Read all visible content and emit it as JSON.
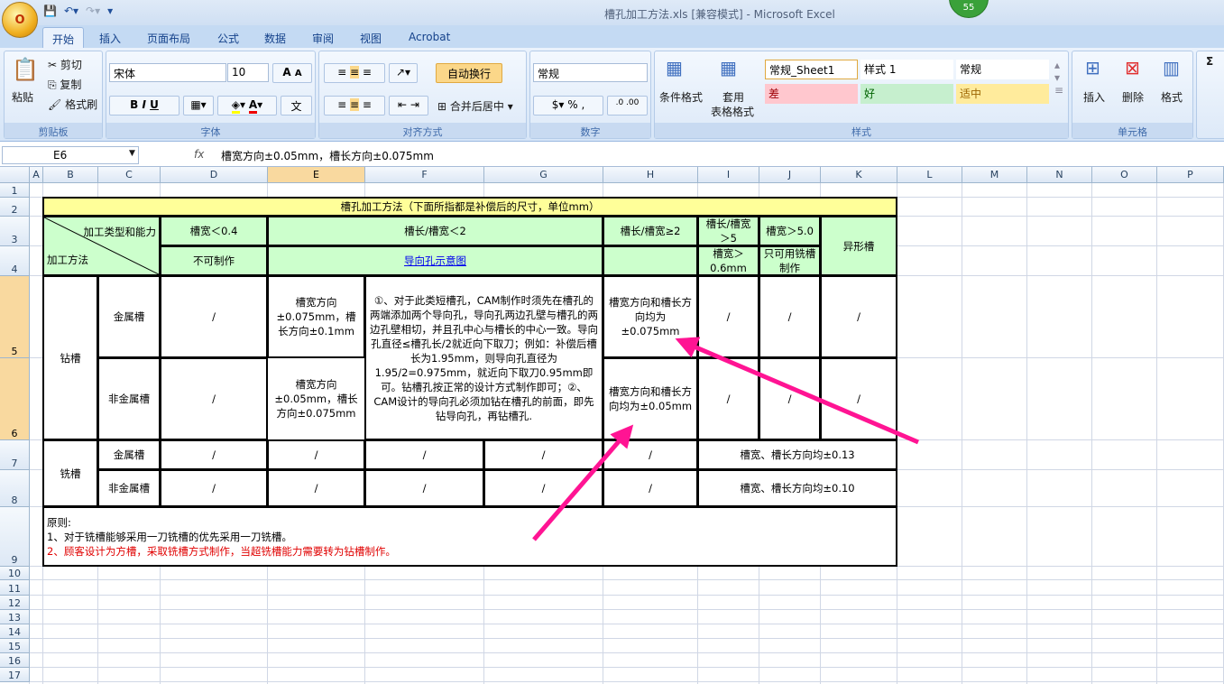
{
  "window": {
    "title": "槽孔加工方法.xls  [兼容模式] - Microsoft Excel",
    "badge": "55",
    "office_button": "O"
  },
  "tabs": [
    "开始",
    "插入",
    "页面布局",
    "公式",
    "数据",
    "审阅",
    "视图",
    "Acrobat"
  ],
  "ribbon": {
    "clipboard": {
      "paste": "粘贴",
      "cut": "剪切",
      "copy": "复制",
      "format_painter": "格式刷",
      "label": "剪贴板"
    },
    "font": {
      "name": "宋体",
      "size": "10",
      "bold": "B",
      "italic": "I",
      "underline": "U",
      "label": "字体",
      "grow": "A",
      "shrink": "A",
      "font_color": "A",
      "phonetic": "文"
    },
    "alignment": {
      "wrap": "自动换行",
      "merge": "合并后居中",
      "label": "对齐方式"
    },
    "number": {
      "format": "常规",
      "percent": "%",
      "comma": ",",
      "label": "数字"
    },
    "styles": {
      "conditional": "条件格式",
      "table_a": "套用",
      "table_b": "表格格式",
      "cells": [
        {
          "text": "常规_Sheet1",
          "bg": "#ffffff",
          "fg": "#000000"
        },
        {
          "text": "样式 1",
          "bg": "#ffffff",
          "fg": "#000000"
        },
        {
          "text": "常规",
          "bg": "#ffffff",
          "fg": "#000000"
        },
        {
          "text": "差",
          "bg": "#ffc7ce",
          "fg": "#9c0006"
        },
        {
          "text": "好",
          "bg": "#c6efce",
          "fg": "#006100"
        },
        {
          "text": "适中",
          "bg": "#ffeb9c",
          "fg": "#9c6500"
        }
      ],
      "label": "样式"
    },
    "cells": {
      "insert": "插入",
      "delete": "删除",
      "format": "格式",
      "label": "单元格"
    },
    "editing": {
      "sum": "Σ"
    }
  },
  "formula_bar": {
    "name_box": "E6",
    "fx": "fx",
    "formula": "槽宽方向±0.05mm，槽长方向±0.075mm"
  },
  "columns": [
    "A",
    "B",
    "C",
    "D",
    "E",
    "F",
    "G",
    "H",
    "I",
    "J",
    "K",
    "L",
    "M",
    "N",
    "O",
    "P"
  ],
  "rows": [
    "1",
    "2",
    "3",
    "4",
    "5",
    "6",
    "7",
    "8",
    "9",
    "10",
    "11",
    "12",
    "13",
    "14",
    "15",
    "16",
    "17"
  ],
  "selected_cell": "E6",
  "colors": {
    "header_green": "#ccffcc",
    "title_yellow": "#ffff99",
    "arrow": "#ff1493"
  },
  "sheet_cells": [
    {
      "ref": "B2:K2",
      "text": "槽孔加工方法（下面所指都是补偿后的尺寸，单位mm）",
      "cls": "y"
    },
    {
      "ref": "B3:C4",
      "text": "",
      "cls": "g",
      "diag": true,
      "tr": "加工类型和能力",
      "bl": "加工方法"
    },
    {
      "ref": "D3",
      "text": "槽宽＜0.4",
      "cls": "g"
    },
    {
      "ref": "E3:G3",
      "text": "槽长/槽宽＜2",
      "cls": "g"
    },
    {
      "ref": "H3",
      "text": "槽长/槽宽≥2",
      "cls": "g"
    },
    {
      "ref": "I3",
      "text": "槽长/槽宽＞5",
      "cls": "g"
    },
    {
      "ref": "J3",
      "text": "槽宽＞5.0",
      "cls": "g"
    },
    {
      "ref": "K3:K4",
      "text": "异形槽",
      "cls": "g"
    },
    {
      "ref": "D4",
      "text": "不可制作",
      "cls": "g"
    },
    {
      "ref": "E4:G4",
      "text": "导向孔示意图",
      "cls": "g link"
    },
    {
      "ref": "H4",
      "text": "",
      "cls": "g"
    },
    {
      "ref": "I4",
      "text": "槽宽＞0.6mm",
      "cls": "g"
    },
    {
      "ref": "J4",
      "text": "只可用铣槽制作",
      "cls": "g"
    },
    {
      "ref": "B5:B6",
      "text": "钻槽"
    },
    {
      "ref": "C5",
      "text": "金属槽"
    },
    {
      "ref": "D5",
      "text": "/"
    },
    {
      "ref": "E5",
      "text": "槽宽方向±0.075mm，槽长方向±0.1mm"
    },
    {
      "ref": "F5:G6",
      "text": "①、对于此类短槽孔，CAM制作时须先在槽孔的两端添加两个导向孔，导向孔两边孔壁与槽孔的两边孔壁相切，并且孔中心与槽长的中心一致。导向孔直径≤槽孔长/2就近向下取刀；例如：补偿后槽长为1.95mm，则导向孔直径为1.95/2=0.975mm，就近向下取刀0.95mm即可。钻槽孔按正常的设计方式制作即可；②、CAM设计的导向孔必须加钻在槽孔的前面，即先钻导向孔，再钻槽孔."
    },
    {
      "ref": "H5",
      "text": "槽宽方向和槽长方向均为±0.075mm"
    },
    {
      "ref": "I5",
      "text": "/"
    },
    {
      "ref": "J5",
      "text": "/"
    },
    {
      "ref": "K5",
      "text": "/"
    },
    {
      "ref": "C6",
      "text": "非金属槽"
    },
    {
      "ref": "D6",
      "text": "/"
    },
    {
      "ref": "E6",
      "text": "槽宽方向±0.05mm，槽长方向±0.075mm"
    },
    {
      "ref": "H6",
      "text": "槽宽方向和槽长方向均为±0.05mm"
    },
    {
      "ref": "I6",
      "text": "/"
    },
    {
      "ref": "J6",
      "text": "/"
    },
    {
      "ref": "K6",
      "text": "/"
    },
    {
      "ref": "B7:B8",
      "text": "铣槽"
    },
    {
      "ref": "C7",
      "text": "金属槽"
    },
    {
      "ref": "D7",
      "text": "/"
    },
    {
      "ref": "E7",
      "text": "/"
    },
    {
      "ref": "F7",
      "text": "/"
    },
    {
      "ref": "G7",
      "text": "/"
    },
    {
      "ref": "H7",
      "text": "/"
    },
    {
      "ref": "I7:K7",
      "text": "槽宽、槽长方向均±0.13"
    },
    {
      "ref": "C8",
      "text": "非金属槽"
    },
    {
      "ref": "D8",
      "text": "/"
    },
    {
      "ref": "E8",
      "text": "/"
    },
    {
      "ref": "F8",
      "text": "/"
    },
    {
      "ref": "G8",
      "text": "/"
    },
    {
      "ref": "H8",
      "text": "/"
    },
    {
      "ref": "I8:K8",
      "text": "槽宽、槽长方向均±0.10"
    },
    {
      "ref": "B9:K9",
      "text": "",
      "notes": true
    }
  ],
  "notes": {
    "title": "原则:",
    "line1": "1、对于铣槽能够采用一刀铣槽的优先采用一刀铣槽。",
    "line2": "2、顾客设计为方槽，采取铣槽方式制作，当超铣槽能力需要转为钻槽制作。"
  }
}
